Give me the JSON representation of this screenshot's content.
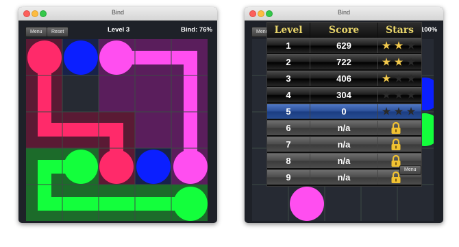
{
  "colors": {
    "red": "#ff2a6a",
    "blue": "#0b1fff",
    "magenta": "#ff4ef0",
    "green": "#13ff3c",
    "star_on": "#f2c94c",
    "lock": "#f1c232",
    "header_text": "#e8d56a",
    "row_highlight": "#2b4f98"
  },
  "left_window": {
    "title": "Bind",
    "menu_label": "Menu",
    "reset_label": "Reset",
    "level_label": "Level 3",
    "bind_label": "Bind: 76%"
  },
  "right_window": {
    "title": "Bind",
    "menu_label": "Menu",
    "bind_partial": "100%",
    "bottom_menu_label": "Menu",
    "table": {
      "headers": [
        "Level",
        "Score",
        "Stars"
      ],
      "rows": [
        {
          "level": "1",
          "score": "629",
          "stars": 2,
          "state": "played"
        },
        {
          "level": "2",
          "score": "722",
          "stars": 2,
          "state": "played"
        },
        {
          "level": "3",
          "score": "406",
          "stars": 1,
          "state": "played"
        },
        {
          "level": "4",
          "score": "304",
          "stars": 0,
          "state": "played"
        },
        {
          "level": "5",
          "score": "0",
          "stars": 0,
          "state": "current"
        },
        {
          "level": "6",
          "score": "n/a",
          "stars": 0,
          "state": "locked"
        },
        {
          "level": "7",
          "score": "n/a",
          "stars": 0,
          "state": "locked"
        },
        {
          "level": "8",
          "score": "n/a",
          "stars": 0,
          "state": "locked"
        },
        {
          "level": "9",
          "score": "n/a",
          "stars": 0,
          "state": "locked"
        }
      ]
    }
  },
  "icons": {
    "star": "star-icon",
    "lock": "lock-icon"
  }
}
